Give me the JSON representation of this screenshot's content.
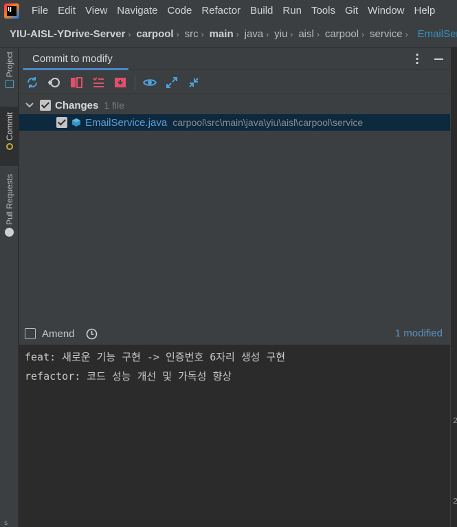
{
  "menubar": {
    "items": [
      {
        "label": "File"
      },
      {
        "label": "Edit"
      },
      {
        "label": "View"
      },
      {
        "label": "Navigate"
      },
      {
        "label": "Code"
      },
      {
        "label": "Refactor"
      },
      {
        "label": "Build"
      },
      {
        "label": "Run"
      },
      {
        "label": "Tools"
      },
      {
        "label": "Git"
      },
      {
        "label": "Window"
      },
      {
        "label": "Help"
      }
    ]
  },
  "breadcrumb": {
    "items": [
      {
        "label": "YIU-AISL-YDrive-Server"
      },
      {
        "label": "carpool"
      },
      {
        "label": "src"
      },
      {
        "label": "main"
      },
      {
        "label": "java"
      },
      {
        "label": "yiu"
      },
      {
        "label": "aisl"
      },
      {
        "label": "carpool"
      },
      {
        "label": "service"
      },
      {
        "label": "EmailService"
      }
    ]
  },
  "toolstrip": {
    "project_label": "Project",
    "commit_label": "Commit",
    "pull_requests_label": "Pull Requests",
    "bottom_stub": "s"
  },
  "panel": {
    "tab_label": "Commit to modify"
  },
  "changes": {
    "group_label": "Changes",
    "count": "1 file",
    "files": [
      {
        "name": "EmailService.java",
        "path": "carpool\\src\\main\\java\\yiu\\aisl\\carpool\\service"
      }
    ]
  },
  "amend": {
    "label": "Amend",
    "modified_count": "1 modified"
  },
  "commit_message": {
    "lines": [
      "feat: 새로운 기능 구현 -> 인증번호 6자리 생성 구현",
      "refactor: 코드 성능 개선 및 가독성 향상"
    ]
  },
  "right_gutter": {
    "numbers": [
      "2",
      "2"
    ]
  },
  "colors": {
    "accent": "#4a88c7",
    "file_blue": "#5e9ed6",
    "selected_row": "#0d293e",
    "panel_bg": "#3c3f41",
    "editor_bg": "#2b2b2b"
  }
}
